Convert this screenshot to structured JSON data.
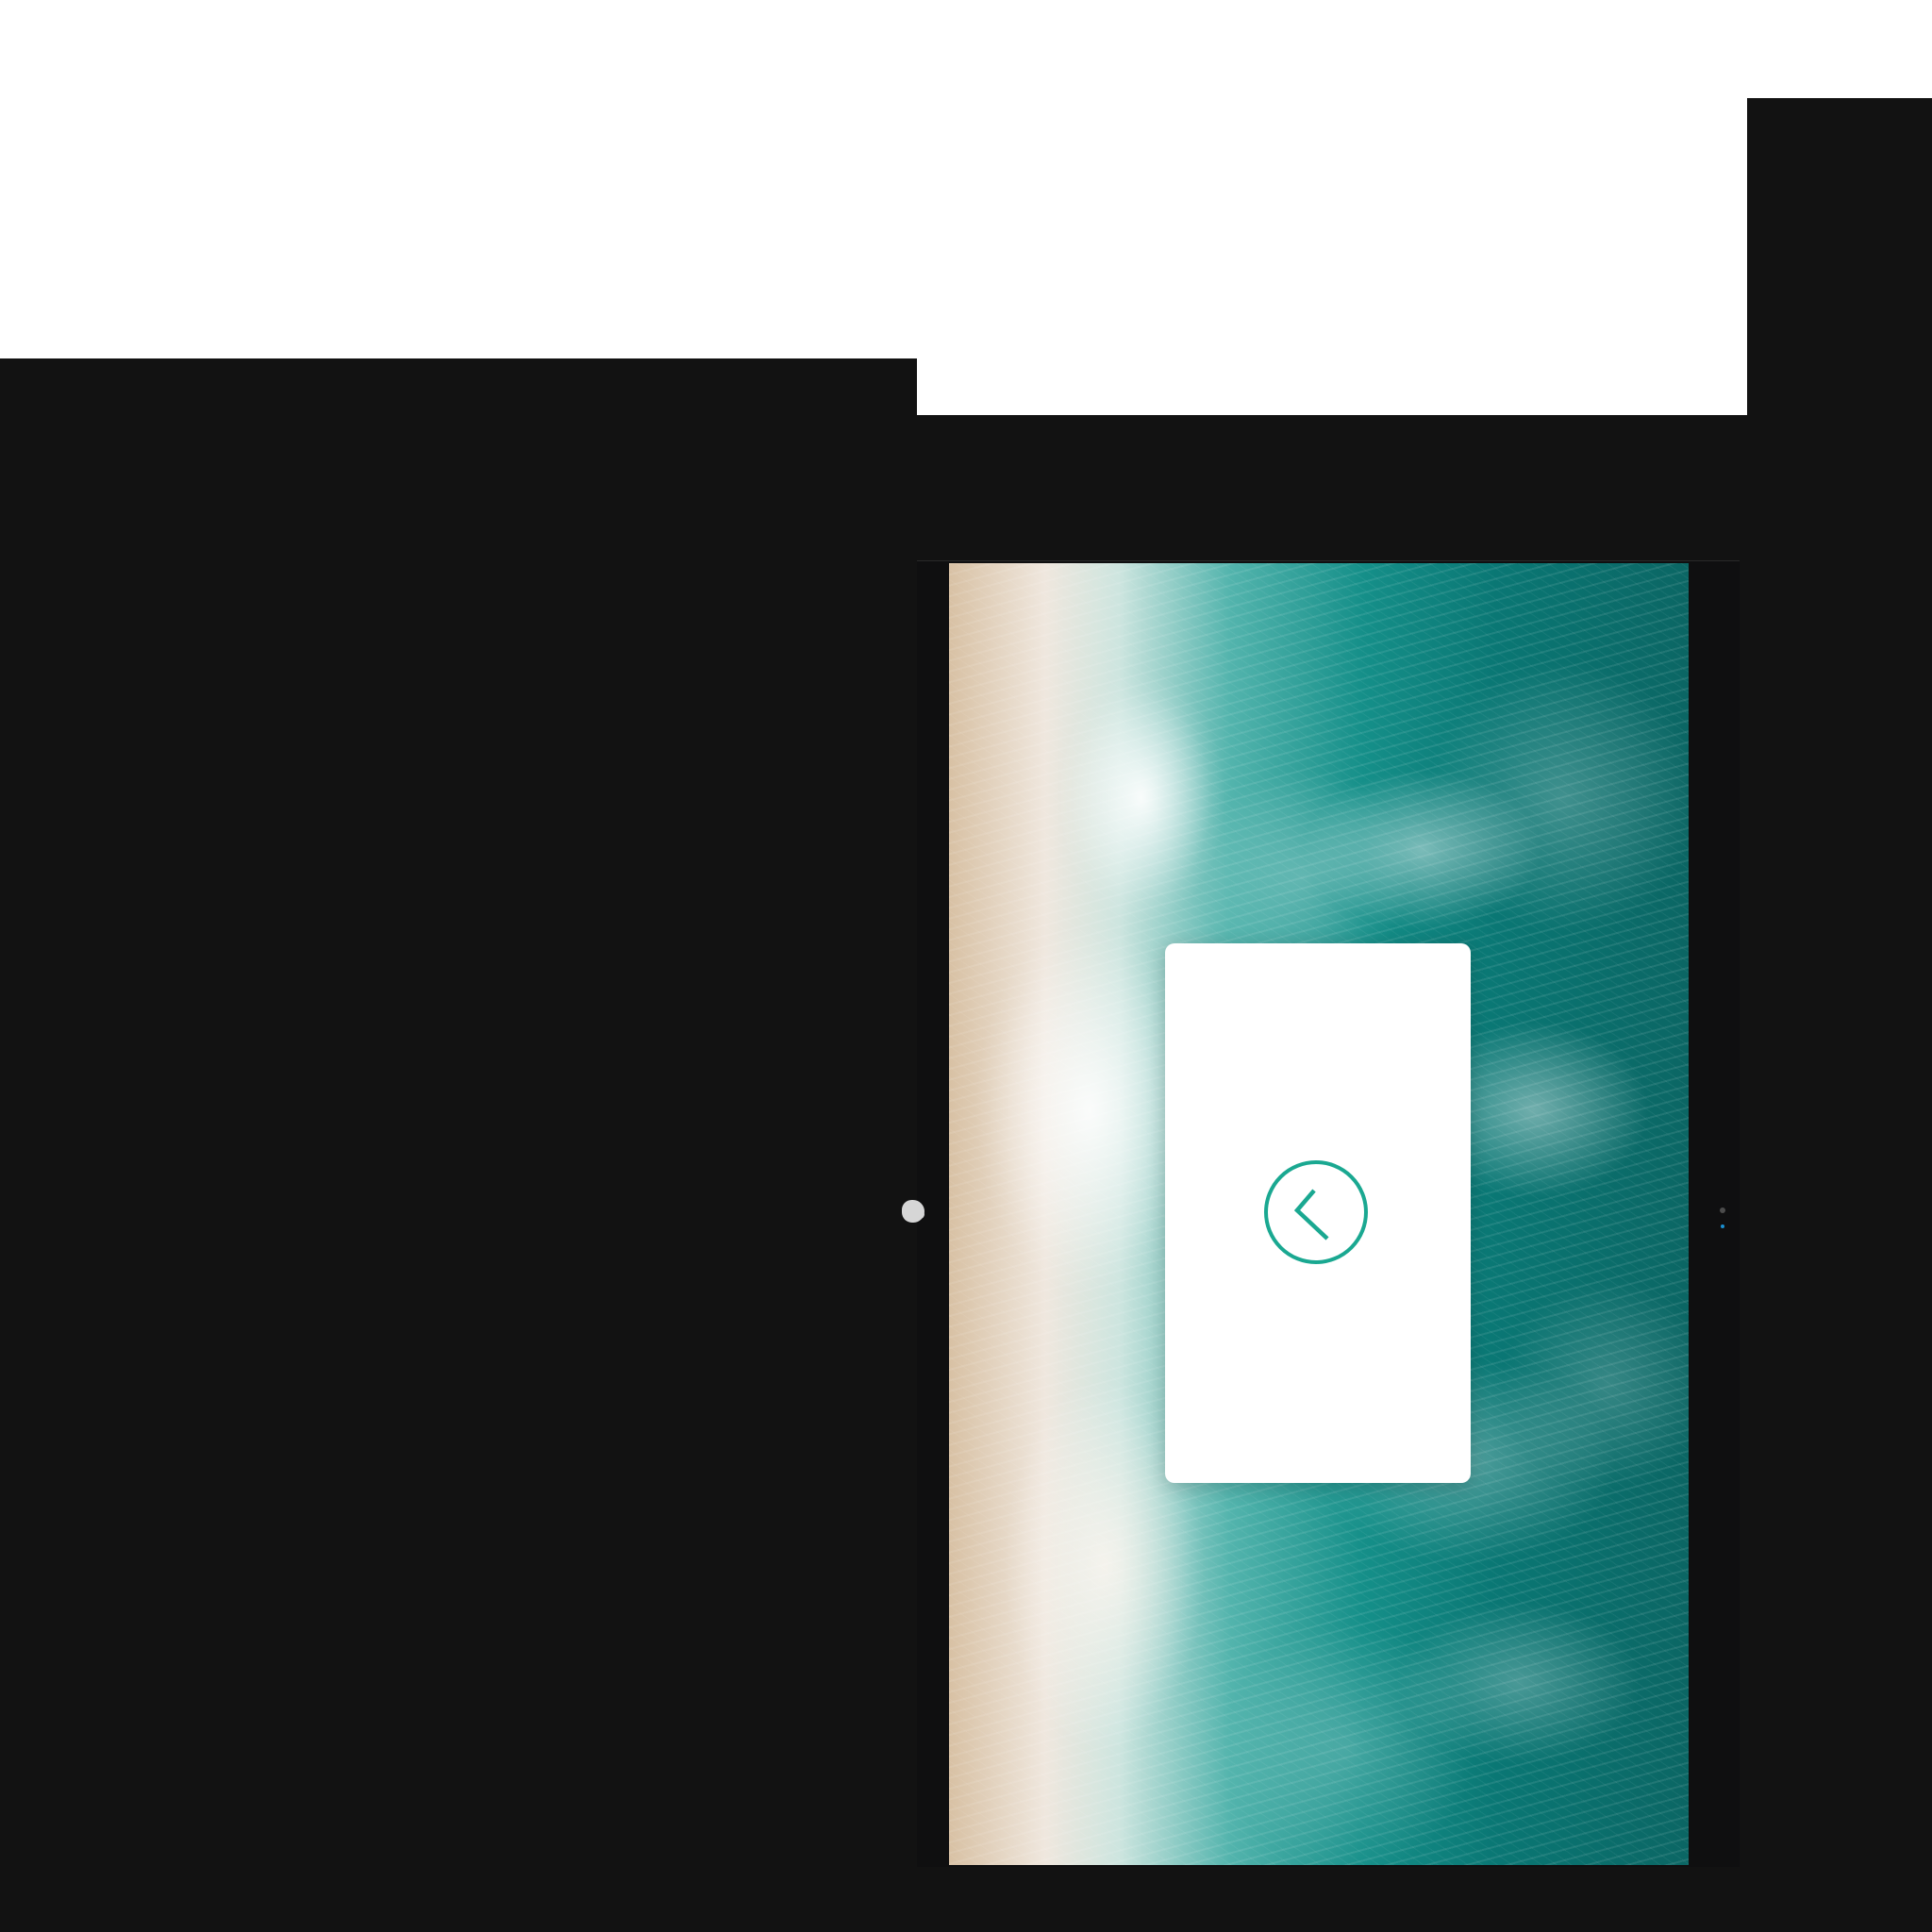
{
  "screen": {
    "background_color": "#ffffff",
    "dark_color": "#121212"
  },
  "photo": {
    "subject": "ocean waves",
    "colors": {
      "sand": "#d8c1a4",
      "foam": "#efe7de",
      "water_light": "#53b4ad",
      "water_mid": "#158f89",
      "water_dark": "#0a7774"
    }
  },
  "dialog": {
    "background_color": "#ffffff",
    "back_icon": "chevron-left-circle-icon",
    "accent_color": "#1aa891"
  },
  "controls": {
    "left_icon": "grab-handle-icon",
    "right_indicator": "edge-indicator-icon"
  }
}
